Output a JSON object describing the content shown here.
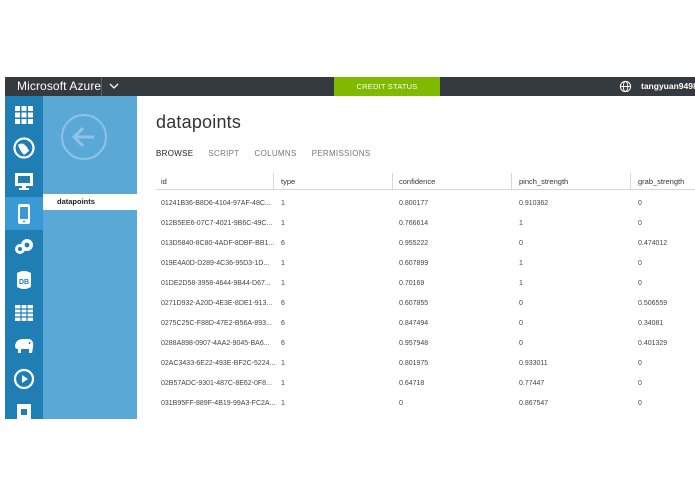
{
  "topbar": {
    "brand": "Microsoft Azure",
    "credit_status": "CREDIT STATUS",
    "user": "tangyuan9498@"
  },
  "rail": {
    "icons": [
      "all-items-icon",
      "web-sites-icon",
      "virtual-machines-icon",
      "mobile-services-icon",
      "cloud-services-icon",
      "sql-databases-icon",
      "storage-icon",
      "hdinsight-icon",
      "media-services-icon",
      "service-bus-icon"
    ],
    "active_index": 3
  },
  "subnav": {
    "item": "datapoints"
  },
  "page": {
    "title": "datapoints",
    "tabs": [
      "BROWSE",
      "SCRIPT",
      "COLUMNS",
      "PERMISSIONS"
    ],
    "active_tab": 0
  },
  "table": {
    "columns": [
      "id",
      "type",
      "confidence",
      "pinch_strength",
      "grab_strength"
    ],
    "rows": [
      [
        "01241B36-B8D6-4104-97AF-48C...",
        "1",
        "0.800177",
        "0.910362",
        "0"
      ],
      [
        "012B5EE6-07C7-4021-9B6C-49C...",
        "1",
        "0.766614",
        "1",
        "0"
      ],
      [
        "013D5840-8C80-4ADF-8DBF-BB1...",
        "6",
        "0.955222",
        "0",
        "0.474012"
      ],
      [
        "019E4A0D-D289-4C36-95D3-1D...",
        "1",
        "0.607899",
        "1",
        "0"
      ],
      [
        "01DE2D58-3958-4644-9B44-D67...",
        "1",
        "0.70169",
        "1",
        "0"
      ],
      [
        "0271D932-A20D-4E3E-8DE1-913...",
        "6",
        "0.607855",
        "0",
        "0.506559"
      ],
      [
        "0275C25C-F88D-47E2-B56A-893...",
        "6",
        "0.847494",
        "0",
        "0.34081"
      ],
      [
        "0288A898-0907-4AA2-9045-BA6...",
        "6",
        "0.957948",
        "0",
        "0.401329"
      ],
      [
        "02AC3433-6E22-493E-BF2C-5224...",
        "1",
        "0.801975",
        "0.933011",
        "0"
      ],
      [
        "02B57ADC-9301-487C-8E62-0F8...",
        "1",
        "0.64718",
        "0.77447",
        "0"
      ],
      [
        "031B95FF-889F-4B19-99A3-FC2A...",
        "1",
        "0",
        "0.867547",
        "0"
      ]
    ]
  },
  "colors": {
    "topbar": "#353a3e",
    "credit": "#7fba00",
    "rail": "#1f7fb5",
    "subnav": "#5aa8d6"
  }
}
